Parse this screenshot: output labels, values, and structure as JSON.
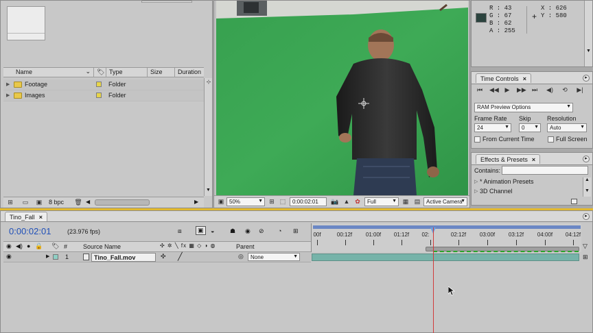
{
  "project": {
    "columns": {
      "name": "Name",
      "type": "Type",
      "size": "Size",
      "duration": "Duration"
    },
    "items": [
      {
        "name": "Footage",
        "type": "Folder"
      },
      {
        "name": "Images",
        "type": "Folder"
      }
    ],
    "bpc": "8 bpc"
  },
  "viewer": {
    "zoom": "50%",
    "timecode": "0:00:02:01",
    "resolution": "Full",
    "camera": "Active Camera"
  },
  "info": {
    "r": "R : 43",
    "g": "G : 67",
    "b": "B : 62",
    "a": "A : 255",
    "x": "X : 626",
    "y": "Y : 580",
    "swatch_color": "#2b433e"
  },
  "time_controls": {
    "tab": "Time Controls",
    "ram_preview": "RAM Preview Options",
    "frame_rate_label": "Frame Rate",
    "skip_label": "Skip",
    "resolution_label": "Resolution",
    "frame_rate": "24",
    "skip": "0",
    "resolution": "Auto",
    "from_current": "From Current Time",
    "full_screen": "Full Screen"
  },
  "effects": {
    "tab": "Effects & Presets",
    "contains_label": "Contains:",
    "items": [
      "* Animation Presets",
      "3D Channel"
    ]
  },
  "timeline": {
    "tab": "Tino_Fall",
    "timecode": "0:00:02:01",
    "fps": "(23.976 fps)",
    "col_hash": "#",
    "col_source": "Source Name",
    "col_parent": "Parent",
    "ruler_labels": [
      "00f",
      "00:12f",
      "01:00f",
      "01:12f",
      "02:",
      "02:12f",
      "03:00f",
      "03:12f",
      "04:00f",
      "04:12f"
    ],
    "layers": [
      {
        "index": "1",
        "name": "Tino_Fall.mov",
        "parent": "None"
      }
    ]
  }
}
